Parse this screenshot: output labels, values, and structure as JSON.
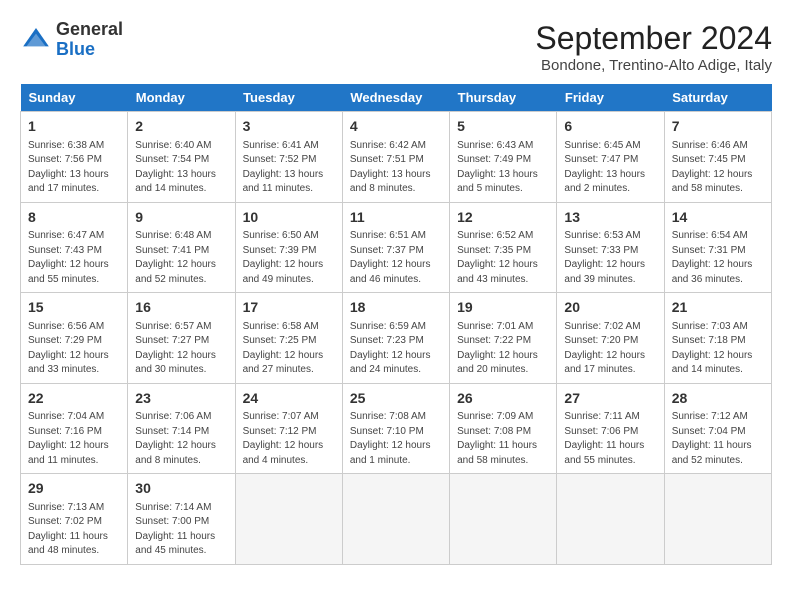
{
  "header": {
    "logo_general": "General",
    "logo_blue": "Blue",
    "month_title": "September 2024",
    "location": "Bondone, Trentino-Alto Adige, Italy"
  },
  "weekdays": [
    "Sunday",
    "Monday",
    "Tuesday",
    "Wednesday",
    "Thursday",
    "Friday",
    "Saturday"
  ],
  "weeks": [
    [
      {
        "day": "1",
        "sunrise": "6:38 AM",
        "sunset": "7:56 PM",
        "daylight": "13 hours and 17 minutes."
      },
      {
        "day": "2",
        "sunrise": "6:40 AM",
        "sunset": "7:54 PM",
        "daylight": "13 hours and 14 minutes."
      },
      {
        "day": "3",
        "sunrise": "6:41 AM",
        "sunset": "7:52 PM",
        "daylight": "13 hours and 11 minutes."
      },
      {
        "day": "4",
        "sunrise": "6:42 AM",
        "sunset": "7:51 PM",
        "daylight": "13 hours and 8 minutes."
      },
      {
        "day": "5",
        "sunrise": "6:43 AM",
        "sunset": "7:49 PM",
        "daylight": "13 hours and 5 minutes."
      },
      {
        "day": "6",
        "sunrise": "6:45 AM",
        "sunset": "7:47 PM",
        "daylight": "13 hours and 2 minutes."
      },
      {
        "day": "7",
        "sunrise": "6:46 AM",
        "sunset": "7:45 PM",
        "daylight": "12 hours and 58 minutes."
      }
    ],
    [
      {
        "day": "8",
        "sunrise": "6:47 AM",
        "sunset": "7:43 PM",
        "daylight": "12 hours and 55 minutes."
      },
      {
        "day": "9",
        "sunrise": "6:48 AM",
        "sunset": "7:41 PM",
        "daylight": "12 hours and 52 minutes."
      },
      {
        "day": "10",
        "sunrise": "6:50 AM",
        "sunset": "7:39 PM",
        "daylight": "12 hours and 49 minutes."
      },
      {
        "day": "11",
        "sunrise": "6:51 AM",
        "sunset": "7:37 PM",
        "daylight": "12 hours and 46 minutes."
      },
      {
        "day": "12",
        "sunrise": "6:52 AM",
        "sunset": "7:35 PM",
        "daylight": "12 hours and 43 minutes."
      },
      {
        "day": "13",
        "sunrise": "6:53 AM",
        "sunset": "7:33 PM",
        "daylight": "12 hours and 39 minutes."
      },
      {
        "day": "14",
        "sunrise": "6:54 AM",
        "sunset": "7:31 PM",
        "daylight": "12 hours and 36 minutes."
      }
    ],
    [
      {
        "day": "15",
        "sunrise": "6:56 AM",
        "sunset": "7:29 PM",
        "daylight": "12 hours and 33 minutes."
      },
      {
        "day": "16",
        "sunrise": "6:57 AM",
        "sunset": "7:27 PM",
        "daylight": "12 hours and 30 minutes."
      },
      {
        "day": "17",
        "sunrise": "6:58 AM",
        "sunset": "7:25 PM",
        "daylight": "12 hours and 27 minutes."
      },
      {
        "day": "18",
        "sunrise": "6:59 AM",
        "sunset": "7:23 PM",
        "daylight": "12 hours and 24 minutes."
      },
      {
        "day": "19",
        "sunrise": "7:01 AM",
        "sunset": "7:22 PM",
        "daylight": "12 hours and 20 minutes."
      },
      {
        "day": "20",
        "sunrise": "7:02 AM",
        "sunset": "7:20 PM",
        "daylight": "12 hours and 17 minutes."
      },
      {
        "day": "21",
        "sunrise": "7:03 AM",
        "sunset": "7:18 PM",
        "daylight": "12 hours and 14 minutes."
      }
    ],
    [
      {
        "day": "22",
        "sunrise": "7:04 AM",
        "sunset": "7:16 PM",
        "daylight": "12 hours and 11 minutes."
      },
      {
        "day": "23",
        "sunrise": "7:06 AM",
        "sunset": "7:14 PM",
        "daylight": "12 hours and 8 minutes."
      },
      {
        "day": "24",
        "sunrise": "7:07 AM",
        "sunset": "7:12 PM",
        "daylight": "12 hours and 4 minutes."
      },
      {
        "day": "25",
        "sunrise": "7:08 AM",
        "sunset": "7:10 PM",
        "daylight": "12 hours and 1 minute."
      },
      {
        "day": "26",
        "sunrise": "7:09 AM",
        "sunset": "7:08 PM",
        "daylight": "11 hours and 58 minutes."
      },
      {
        "day": "27",
        "sunrise": "7:11 AM",
        "sunset": "7:06 PM",
        "daylight": "11 hours and 55 minutes."
      },
      {
        "day": "28",
        "sunrise": "7:12 AM",
        "sunset": "7:04 PM",
        "daylight": "11 hours and 52 minutes."
      }
    ],
    [
      {
        "day": "29",
        "sunrise": "7:13 AM",
        "sunset": "7:02 PM",
        "daylight": "11 hours and 48 minutes."
      },
      {
        "day": "30",
        "sunrise": "7:14 AM",
        "sunset": "7:00 PM",
        "daylight": "11 hours and 45 minutes."
      },
      null,
      null,
      null,
      null,
      null
    ]
  ]
}
